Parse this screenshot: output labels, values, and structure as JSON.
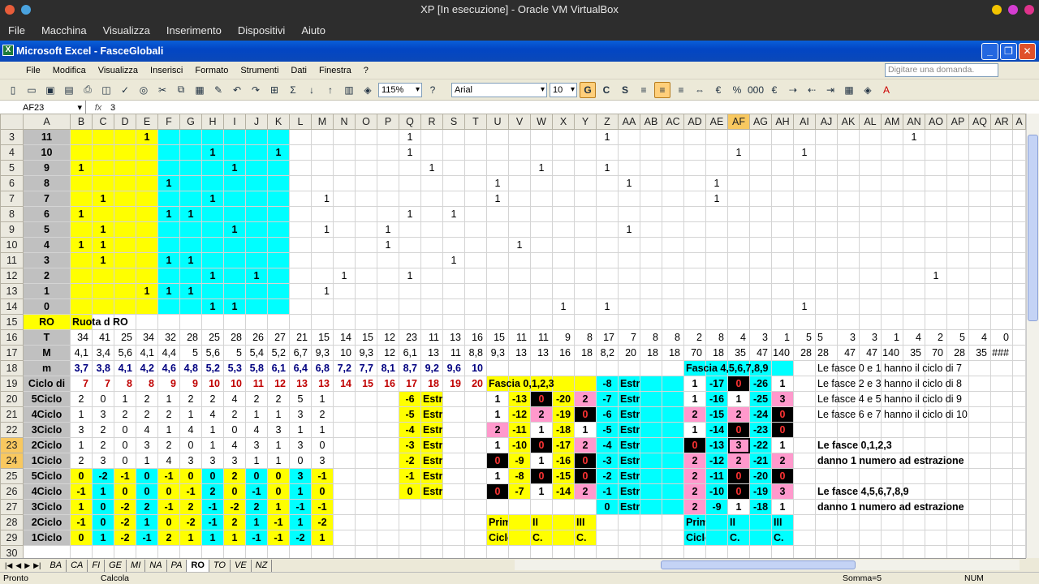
{
  "vbox": {
    "title": "XP [In esecuzione] - Oracle VM VirtualBox",
    "menu": [
      "File",
      "Macchina",
      "Visualizza",
      "Inserimento",
      "Dispositivi",
      "Aiuto"
    ]
  },
  "excel": {
    "title": "Microsoft Excel - FasceGlobali",
    "menu": [
      "File",
      "Modifica",
      "Visualizza",
      "Inserisci",
      "Formato",
      "Strumenti",
      "Dati",
      "Finestra",
      "?"
    ],
    "ask_placeholder": "Digitare una domanda.",
    "zoom": "115%",
    "font": "Arial",
    "font_size": "10",
    "bold": "G",
    "italic": "C",
    "underline": "S",
    "name_box": "AF23",
    "formula": "3"
  },
  "columns": [
    "A",
    "B",
    "C",
    "D",
    "E",
    "F",
    "G",
    "H",
    "I",
    "J",
    "K",
    "L",
    "M",
    "N",
    "O",
    "P",
    "Q",
    "R",
    "S",
    "T",
    "U",
    "V",
    "W",
    "X",
    "Y",
    "Z",
    "AA",
    "AB",
    "AC",
    "AD",
    "AE",
    "AF",
    "AG",
    "AH",
    "AI",
    "AJ",
    "AK",
    "AL",
    "AM",
    "AN",
    "AO",
    "AP",
    "AQ",
    "AR",
    "A"
  ],
  "rows": [
    {
      "n": "3",
      "c": {
        "A": "11",
        "E": "1",
        "Q": "1",
        "Z": "1",
        "AN": "1"
      }
    },
    {
      "n": "4",
      "c": {
        "A": "10",
        "H": "1",
        "K": "1",
        "Q": "1",
        "AF": "1",
        "AI": "1"
      }
    },
    {
      "n": "5",
      "c": {
        "A": "9",
        "B": "1",
        "I": "1",
        "R": "1",
        "W": "1",
        "Z": "1"
      }
    },
    {
      "n": "6",
      "c": {
        "A": "8",
        "F": "1",
        "U": "1",
        "AA": "1",
        "AE": "1"
      }
    },
    {
      "n": "7",
      "c": {
        "A": "7",
        "C": "1",
        "H": "1",
        "M": "1",
        "U": "1",
        "AE": "1"
      }
    },
    {
      "n": "8",
      "c": {
        "A": "6",
        "B": "1",
        "F": "1",
        "G": "1",
        "Q": "1",
        "S": "1"
      }
    },
    {
      "n": "9",
      "c": {
        "A": "5",
        "C": "1",
        "I": "1",
        "M": "1",
        "P": "1",
        "AA": "1"
      }
    },
    {
      "n": "10",
      "c": {
        "A": "4",
        "B": "1",
        "C": "1",
        "P": "1",
        "V": "1"
      }
    },
    {
      "n": "11",
      "c": {
        "A": "3",
        "C": "1",
        "F": "1",
        "G": "1",
        "S": "1"
      }
    },
    {
      "n": "12",
      "c": {
        "A": "2",
        "H": "1",
        "J": "1",
        "N": "1",
        "Q": "1",
        "AO": "1"
      }
    },
    {
      "n": "13",
      "c": {
        "A": "1",
        "E": "1",
        "F": "1",
        "G": "1",
        "M": "1"
      }
    },
    {
      "n": "14",
      "c": {
        "A": "0",
        "H": "1",
        "I": "1",
        "X": "1",
        "Z": "1",
        "AI": "1"
      }
    },
    {
      "n": "15",
      "c": {
        "A": "RO",
        "B": "Ruota d RO"
      }
    },
    {
      "n": "16",
      "c": {
        "A": "T",
        "B": "34",
        "C": "41",
        "D": "25",
        "E": "34",
        "F": "32",
        "G": "28",
        "H": "25",
        "I": "28",
        "J": "26",
        "K": "27",
        "L": "21",
        "M": "15",
        "N": "14",
        "O": "15",
        "P": "12",
        "Q": "23",
        "R": "11",
        "S": "13",
        "T": "16",
        "U": "15",
        "V": "11",
        "W": "11",
        "X": "9",
        "Y": "8",
        "Z": "17",
        "AA": "7",
        "AB": "8",
        "AC": "8",
        "AD": "2",
        "AE": "8",
        "AF": "4",
        "AG": "3",
        "AH": "1",
        "AI": "5",
        "AJ": "5",
        "AK": "3",
        "AL": "3",
        "AM": "1",
        "AN": "4",
        "AO": "2",
        "AP": "5",
        "AQ": "4",
        "AR": "0"
      }
    },
    {
      "n": "17",
      "c": {
        "A": "M",
        "B": "4,1",
        "C": "3,4",
        "D": "5,6",
        "E": "4,1",
        "F": "4,4",
        "G": "5",
        "H": "5,6",
        "I": "5",
        "J": "5,4",
        "K": "5,2",
        "L": "6,7",
        "M": "9,3",
        "N": "10",
        "O": "9,3",
        "P": "12",
        "Q": "6,1",
        "R": "13",
        "S": "11",
        "T": "8,8",
        "U": "9,3",
        "V": "13",
        "W": "13",
        "X": "16",
        "Y": "18",
        "Z": "8,2",
        "AA": "20",
        "AB": "18",
        "AC": "18",
        "AD": "70",
        "AE": "18",
        "AF": "35",
        "AG": "47",
        "AH": "140",
        "AI": "28",
        "AJ": "28",
        "AK": "47",
        "AL": "47",
        "AM": "140",
        "AN": "35",
        "AO": "70",
        "AP": "28",
        "AQ": "35",
        "AR": "###"
      }
    },
    {
      "n": "18",
      "c": {
        "A": "m",
        "B": "3,7",
        "C": "3,8",
        "D": "4,1",
        "E": "4,2",
        "F": "4,6",
        "G": "4,8",
        "H": "5,2",
        "I": "5,3",
        "J": "5,8",
        "K": "6,1",
        "L": "6,4",
        "M": "6,8",
        "N": "7,2",
        "O": "7,7",
        "P": "8,1",
        "Q": "8,7",
        "R": "9,2",
        "S": "9,6",
        "T": "10",
        "AD": "Fascia 4,5,6,7,8,9",
        "AJ": "Le fasce 0 e 1 hanno il ciclo di 7"
      }
    },
    {
      "n": "19",
      "c": {
        "A": "Ciclo di",
        "B": "7",
        "C": "7",
        "D": "8",
        "E": "8",
        "F": "9",
        "G": "9",
        "H": "10",
        "I": "10",
        "J": "11",
        "K": "12",
        "L": "13",
        "M": "13",
        "N": "14",
        "O": "15",
        "P": "16",
        "Q": "17",
        "R": "18",
        "S": "19",
        "T": "20",
        "U": "Fascia 0,1,2,3",
        "Z": "-8",
        "AA": "Estrazione",
        "AD": "1",
        "AE": "-17",
        "AF": "0",
        "AG": "-26",
        "AH": "1",
        "AJ": "Le fasce 2 e 3 hanno il ciclo di 8"
      }
    },
    {
      "n": "20",
      "c": {
        "A": "5Ciclo",
        "B": "2",
        "C": "0",
        "D": "1",
        "E": "2",
        "F": "1",
        "G": "2",
        "H": "2",
        "I": "4",
        "J": "2",
        "K": "2",
        "L": "5",
        "M": "1",
        "Q": "-6",
        "R": "Estrazione",
        "U": "1",
        "V": "-13",
        "W": "0",
        "X": "-20",
        "Y": "2",
        "Z": "-7",
        "AA": "Estrazione",
        "AD": "1",
        "AE": "-16",
        "AF": "1",
        "AG": "-25",
        "AH": "3",
        "AJ": "Le fasce 4 e 5 hanno il ciclo di 9"
      }
    },
    {
      "n": "21",
      "c": {
        "A": "4Ciclo",
        "B": "1",
        "C": "3",
        "D": "2",
        "E": "2",
        "F": "2",
        "G": "1",
        "H": "4",
        "I": "2",
        "J": "1",
        "K": "1",
        "L": "3",
        "M": "2",
        "Q": "-5",
        "R": "Estrazione",
        "U": "1",
        "V": "-12",
        "W": "2",
        "X": "-19",
        "Y": "0",
        "Z": "-6",
        "AA": "Estrazione",
        "AD": "2",
        "AE": "-15",
        "AF": "2",
        "AG": "-24",
        "AH": "0",
        "AJ": "Le fasce 6 e 7 hanno il ciclo di 10"
      }
    },
    {
      "n": "22",
      "c": {
        "A": "3Ciclo",
        "B": "3",
        "C": "2",
        "D": "0",
        "E": "4",
        "F": "1",
        "G": "4",
        "H": "1",
        "I": "0",
        "J": "4",
        "K": "3",
        "L": "1",
        "M": "1",
        "Q": "-4",
        "R": "Estrazione",
        "U": "2",
        "V": "-11",
        "W": "1",
        "X": "-18",
        "Y": "1",
        "Z": "-5",
        "AA": "Estrazione",
        "AD": "1",
        "AE": "-14",
        "AF": "0",
        "AG": "-23",
        "AH": "0"
      }
    },
    {
      "n": "23",
      "c": {
        "A": "2Ciclo",
        "B": "1",
        "C": "2",
        "D": "0",
        "E": "3",
        "F": "2",
        "G": "0",
        "H": "1",
        "I": "4",
        "J": "3",
        "K": "1",
        "L": "3",
        "M": "0",
        "Q": "-3",
        "R": "Estrazione",
        "U": "1",
        "V": "-10",
        "W": "0",
        "X": "-17",
        "Y": "2",
        "Z": "-4",
        "AA": "Estrazione",
        "AD": "0",
        "AE": "-13",
        "AF": "3",
        "AG": "-22",
        "AH": "1",
        "AJ": "Le fasce 0,1,2,3"
      }
    },
    {
      "n": "24",
      "c": {
        "A": "1Ciclo",
        "B": "2",
        "C": "3",
        "D": "0",
        "E": "1",
        "F": "4",
        "G": "3",
        "H": "3",
        "I": "3",
        "J": "1",
        "K": "1",
        "L": "0",
        "M": "3",
        "Q": "-2",
        "R": "Estrazione",
        "U": "0",
        "V": "-9",
        "W": "1",
        "X": "-16",
        "Y": "0",
        "Z": "-3",
        "AA": "Estrazione",
        "AD": "2",
        "AE": "-12",
        "AF": "2",
        "AG": "-21",
        "AH": "2",
        "AJ": "danno 1 numero ad estrazione"
      }
    },
    {
      "n": "25",
      "c": {
        "A": "5Ciclo",
        "B": "0",
        "C": "-2",
        "D": "-1",
        "E": "0",
        "F": "-1",
        "G": "0",
        "H": "0",
        "I": "2",
        "J": "0",
        "K": "0",
        "L": "3",
        "M": "-1",
        "Q": "-1",
        "R": "Estrazione",
        "U": "1",
        "V": "-8",
        "W": "0",
        "X": "-15",
        "Y": "0",
        "Z": "-2",
        "AA": "Estrazione",
        "AD": "2",
        "AE": "-11",
        "AF": "0",
        "AG": "-20",
        "AH": "0"
      }
    },
    {
      "n": "26",
      "c": {
        "A": "4Ciclo",
        "B": "-1",
        "C": "1",
        "D": "0",
        "E": "0",
        "F": "0",
        "G": "-1",
        "H": "2",
        "I": "0",
        "J": "-1",
        "K": "0",
        "L": "1",
        "M": "0",
        "Q": "0",
        "R": "Estrazione",
        "U": "0",
        "V": "-7",
        "W": "1",
        "X": "-14",
        "Y": "2",
        "Z": "-1",
        "AA": "Estrazione",
        "AD": "2",
        "AE": "-10",
        "AF": "0",
        "AG": "-19",
        "AH": "3",
        "AJ": "Le fasce 4,5,6,7,8,9"
      }
    },
    {
      "n": "27",
      "c": {
        "A": "3Ciclo",
        "B": "1",
        "C": "0",
        "D": "-2",
        "E": "2",
        "F": "-1",
        "G": "2",
        "H": "-1",
        "I": "-2",
        "J": "2",
        "K": "1",
        "L": "-1",
        "M": "-1",
        "Z": "0",
        "AA": "Estrazione",
        "AD": "2",
        "AE": "-9",
        "AF": "1",
        "AG": "-18",
        "AH": "1",
        "AJ": "danno 1 numero ad estrazione"
      }
    },
    {
      "n": "28",
      "c": {
        "A": "2Ciclo",
        "B": "-1",
        "C": "0",
        "D": "-2",
        "E": "1",
        "F": "0",
        "G": "-2",
        "H": "-1",
        "I": "2",
        "J": "1",
        "K": "-1",
        "L": "1",
        "M": "-2",
        "U": "Primo",
        "W": "II",
        "Y": "III",
        "AD": "Primo",
        "AF": "II",
        "AH": "III"
      }
    },
    {
      "n": "29",
      "c": {
        "A": "1Ciclo",
        "B": "0",
        "C": "1",
        "D": "-2",
        "E": "-1",
        "F": "2",
        "G": "1",
        "H": "1",
        "I": "1",
        "J": "-1",
        "K": "-1",
        "L": "-2",
        "M": "1",
        "U": "Ciclo",
        "W": "C.",
        "Y": "C.",
        "AD": "Ciclo",
        "AF": "C.",
        "AH": "C."
      }
    },
    {
      "n": "30",
      "c": {}
    },
    {
      "n": "31",
      "c": {}
    }
  ],
  "sheet_tabs": [
    "BA",
    "CA",
    "FI",
    "GE",
    "MI",
    "NA",
    "PA",
    "RO",
    "TO",
    "VE",
    "NZ"
  ],
  "active_tab": "RO",
  "status": {
    "ready": "Pronto",
    "calc": "Calcola",
    "sum": "Somma=5",
    "num": "NUM"
  },
  "colors": {
    "yellow": "#ffff00",
    "cyan": "#00ffff",
    "pink": "#ff99cc",
    "black": "#000000",
    "header_gray": "#c0c0c0",
    "blue_text": "#000080",
    "red_text": "#c00000"
  }
}
